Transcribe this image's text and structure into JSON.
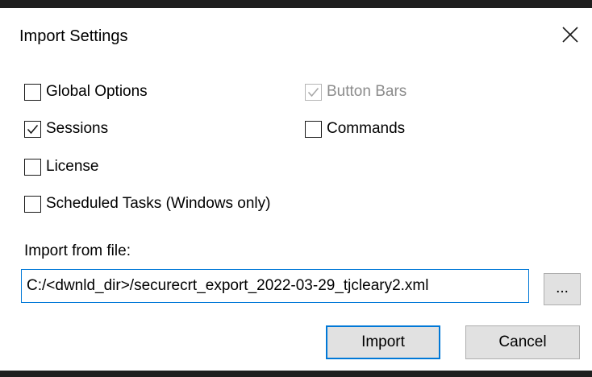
{
  "dialog": {
    "title": "Import Settings",
    "close_icon": "close-icon"
  },
  "options": {
    "global_options": {
      "label": "Global Options",
      "checked": false,
      "enabled": true
    },
    "button_bars": {
      "label": "Button Bars",
      "checked": true,
      "enabled": false
    },
    "sessions": {
      "label": "Sessions",
      "checked": true,
      "enabled": true
    },
    "commands": {
      "label": "Commands",
      "checked": false,
      "enabled": true
    },
    "license": {
      "label": "License",
      "checked": false,
      "enabled": true
    },
    "scheduled_tasks": {
      "label": "Scheduled Tasks (Windows only)",
      "checked": false,
      "enabled": true
    }
  },
  "import_file": {
    "label": "Import from file:",
    "value": "C:/<dwnld_dir>/securecrt_export_2022-03-29_tjcleary2.xml",
    "browse_label": "..."
  },
  "buttons": {
    "import_label": "Import",
    "cancel_label": "Cancel"
  },
  "colors": {
    "accent": "#0078d7",
    "button_face": "#e1e1e1",
    "disabled_text": "#8c8c8c"
  }
}
